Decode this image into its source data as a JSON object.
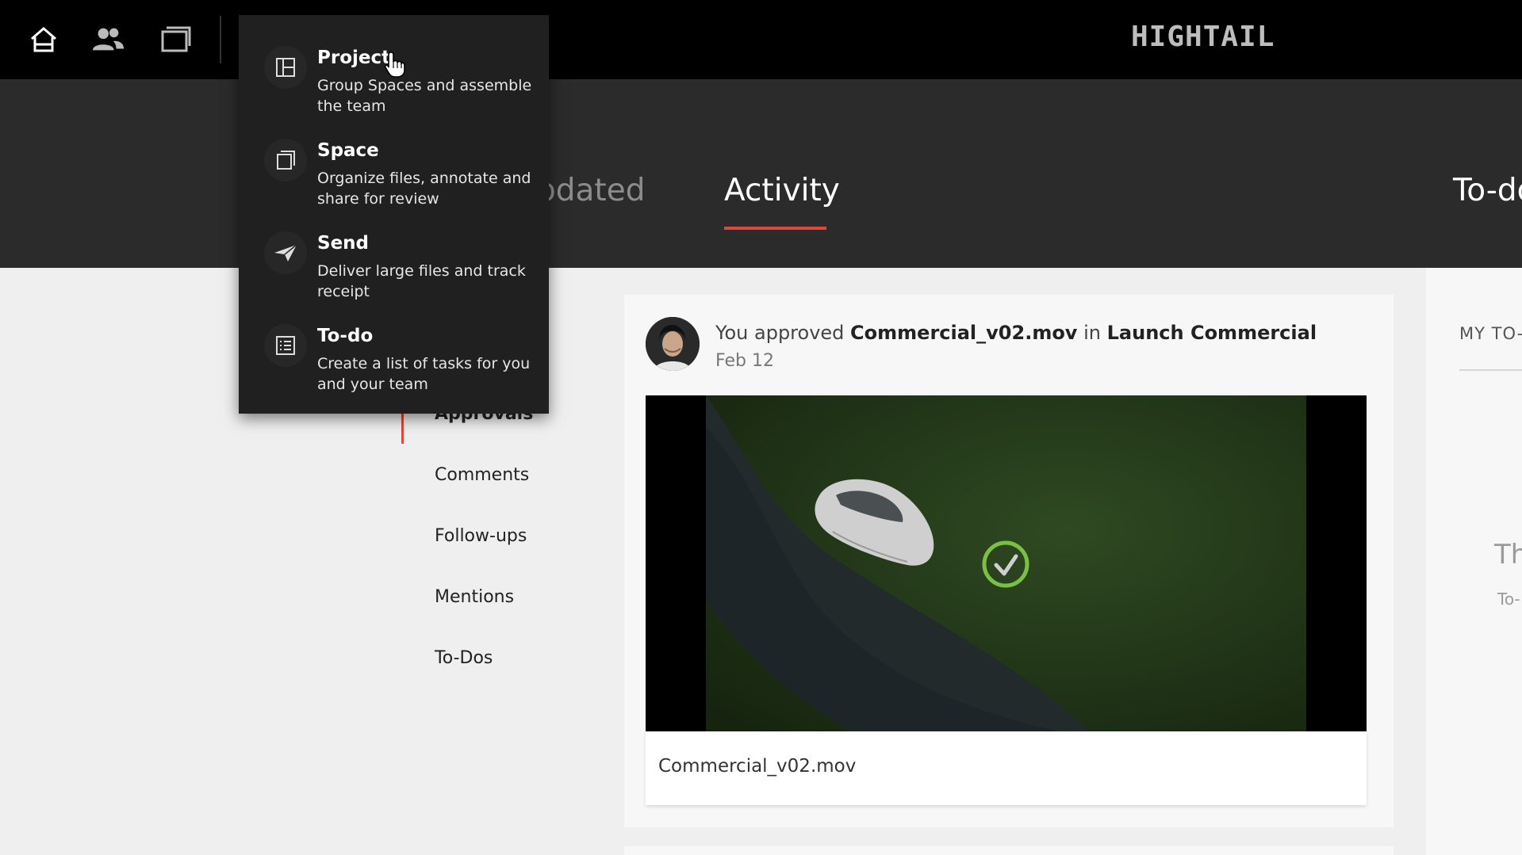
{
  "brand": "HIGHTAIL",
  "nav": {
    "home_icon": "home-icon",
    "people_icon": "people-icon",
    "spaces_icon": "spaces-icon"
  },
  "tabs": [
    {
      "label": "pdated"
    },
    {
      "label": "Activity"
    },
    {
      "label": "To-do"
    }
  ],
  "create_menu": {
    "items": [
      {
        "title": "Project",
        "description": "Group Spaces and assemble the team",
        "icon": "project-icon"
      },
      {
        "title": "Space",
        "description": "Organize files, annotate and share for review",
        "icon": "space-icon"
      },
      {
        "title": "Send",
        "description": "Deliver large files and track receipt",
        "icon": "paper-plane-icon"
      },
      {
        "title": "To-do",
        "description": "Create a list of tasks for you and your team",
        "icon": "checklist-icon"
      }
    ]
  },
  "filters": [
    {
      "label": "Approvals"
    },
    {
      "label": "Comments"
    },
    {
      "label": "Follow-ups"
    },
    {
      "label": "Mentions"
    },
    {
      "label": "To-Dos"
    }
  ],
  "activity": {
    "prefix": "You approved",
    "file": "Commercial_v02.mov",
    "connector": "in",
    "space": "Launch Commercial",
    "date": "Feb 12",
    "filename": "Commercial_v02.mov"
  },
  "right_panel": {
    "title": "MY TO-",
    "empty_title": "Th",
    "empty_sub": "To-"
  },
  "colors": {
    "accent": "#e0463b",
    "approved_green": "#7cc043"
  }
}
